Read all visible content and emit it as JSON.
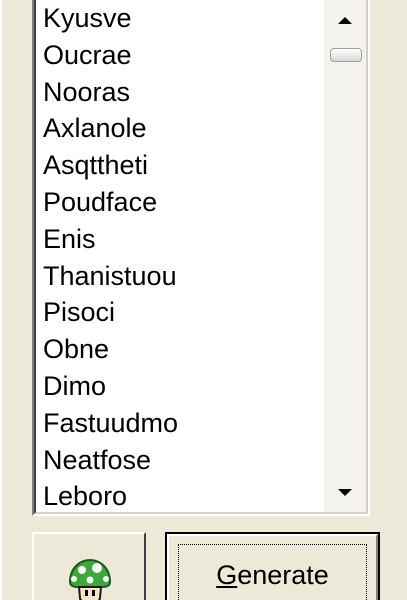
{
  "listbox": {
    "items": [
      "Kyusve",
      "Oucrae",
      "Nooras",
      "Axlanole",
      "Asqttheti",
      "Poudface",
      "Enis",
      "Thanistuou",
      "Pisoci",
      "Obne",
      "Dimo",
      "Fastuudmo",
      "Neatfose",
      "Leboro"
    ],
    "scroll_up_icon": "triangle-up",
    "scroll_down_icon": "triangle-down"
  },
  "icon_button": {
    "icon": "green-mushroom-icon"
  },
  "generate_button": {
    "label": "Generate",
    "mnemonic": "G",
    "rest": "enerate"
  },
  "colors": {
    "window_bg": "#ece9d8",
    "list_bg": "#ffffff",
    "mushroom_green": "#3aa83a"
  }
}
